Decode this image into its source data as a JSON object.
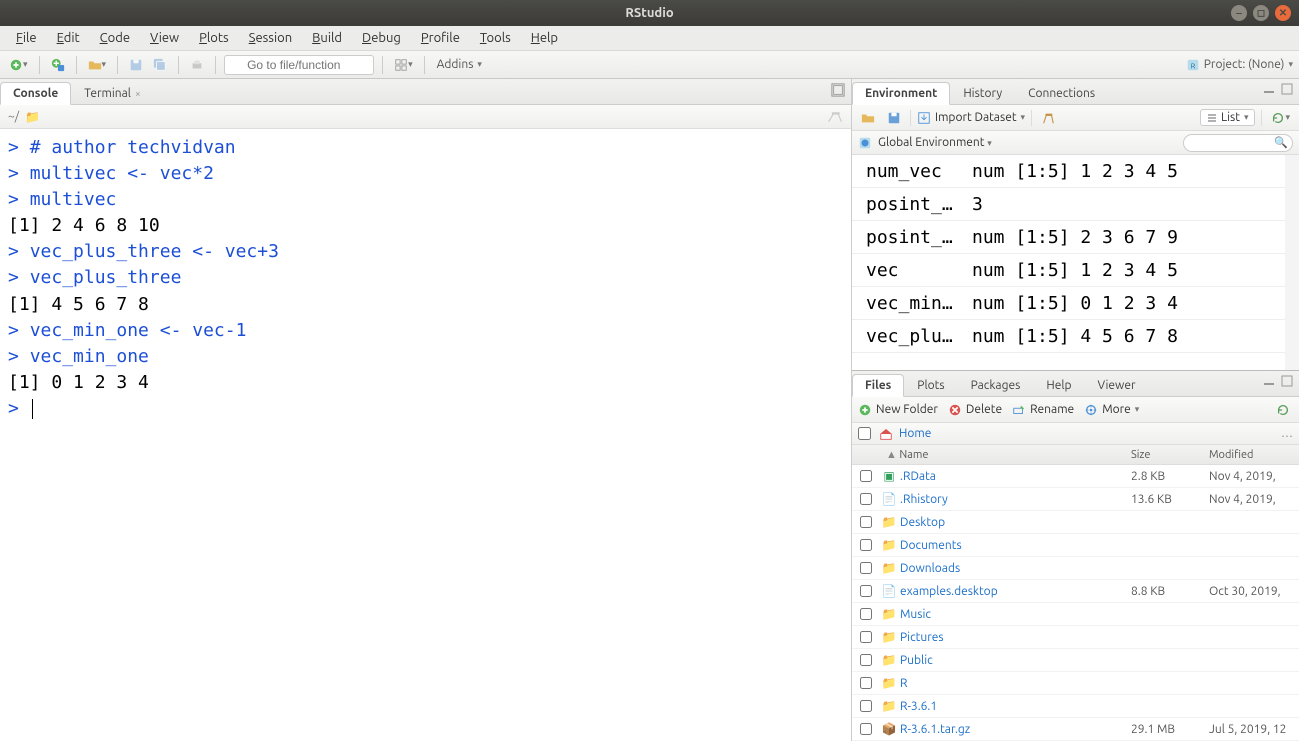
{
  "window": {
    "title": "RStudio"
  },
  "menu": [
    "File",
    "Edit",
    "Code",
    "View",
    "Plots",
    "Session",
    "Build",
    "Debug",
    "Profile",
    "Tools",
    "Help"
  ],
  "toolbar": {
    "goto_placeholder": "Go to file/function",
    "addins": "Addins",
    "project": "Project: (None)"
  },
  "left": {
    "tabs": {
      "console": "Console",
      "terminal": "Terminal"
    },
    "wd": "~/",
    "console_lines": [
      {
        "type": "in",
        "text": "# author techvidvan"
      },
      {
        "type": "in",
        "text": "multivec <- vec*2"
      },
      {
        "type": "in",
        "text": "multivec"
      },
      {
        "type": "out",
        "text": "[1]  2  4  6  8 10"
      },
      {
        "type": "in",
        "text": "vec_plus_three <- vec+3"
      },
      {
        "type": "in",
        "text": "vec_plus_three"
      },
      {
        "type": "out",
        "text": "[1] 4 5 6 7 8"
      },
      {
        "type": "in",
        "text": "vec_min_one <- vec-1"
      },
      {
        "type": "in",
        "text": "vec_min_one"
      },
      {
        "type": "out",
        "text": "[1] 0 1 2 3 4"
      }
    ]
  },
  "env": {
    "tabs": [
      "Environment",
      "History",
      "Connections"
    ],
    "import": "Import Dataset",
    "list": "List",
    "scope": "Global Environment",
    "rows": [
      {
        "name": "num_vec",
        "value": "num [1:5] 1 2 3 4 5"
      },
      {
        "name": "posint_…",
        "value": "3"
      },
      {
        "name": "posint_…",
        "value": "num [1:5] 2 3 6 7 9"
      },
      {
        "name": "vec",
        "value": "num [1:5] 1 2 3 4 5"
      },
      {
        "name": "vec_min…",
        "value": "num [1:5] 0 1 2 3 4"
      },
      {
        "name": "vec_plu…",
        "value": "num [1:5] 4 5 6 7 8"
      }
    ]
  },
  "files": {
    "tabs": [
      "Files",
      "Plots",
      "Packages",
      "Help",
      "Viewer"
    ],
    "actions": {
      "new_folder": "New Folder",
      "delete": "Delete",
      "rename": "Rename",
      "more": "More"
    },
    "breadcrumb": "Home",
    "headers": {
      "name": "Name",
      "size": "Size",
      "modified": "Modified"
    },
    "rows": [
      {
        "icon": "rdata",
        "name": ".RData",
        "size": "2.8 KB",
        "modified": "Nov 4, 2019,"
      },
      {
        "icon": "file",
        "name": ".Rhistory",
        "size": "13.6 KB",
        "modified": "Nov 4, 2019,"
      },
      {
        "icon": "folder",
        "name": "Desktop",
        "size": "",
        "modified": ""
      },
      {
        "icon": "folder",
        "name": "Documents",
        "size": "",
        "modified": ""
      },
      {
        "icon": "folder",
        "name": "Downloads",
        "size": "",
        "modified": ""
      },
      {
        "icon": "file",
        "name": "examples.desktop",
        "size": "8.8 KB",
        "modified": "Oct 30, 2019,"
      },
      {
        "icon": "folder",
        "name": "Music",
        "size": "",
        "modified": ""
      },
      {
        "icon": "folder",
        "name": "Pictures",
        "size": "",
        "modified": ""
      },
      {
        "icon": "folder-lock",
        "name": "Public",
        "size": "",
        "modified": ""
      },
      {
        "icon": "folder",
        "name": "R",
        "size": "",
        "modified": ""
      },
      {
        "icon": "folder",
        "name": "R-3.6.1",
        "size": "",
        "modified": ""
      },
      {
        "icon": "gz",
        "name": "R-3.6.1.tar.gz",
        "size": "29.1 MB",
        "modified": "Jul 5, 2019, 12"
      }
    ]
  }
}
